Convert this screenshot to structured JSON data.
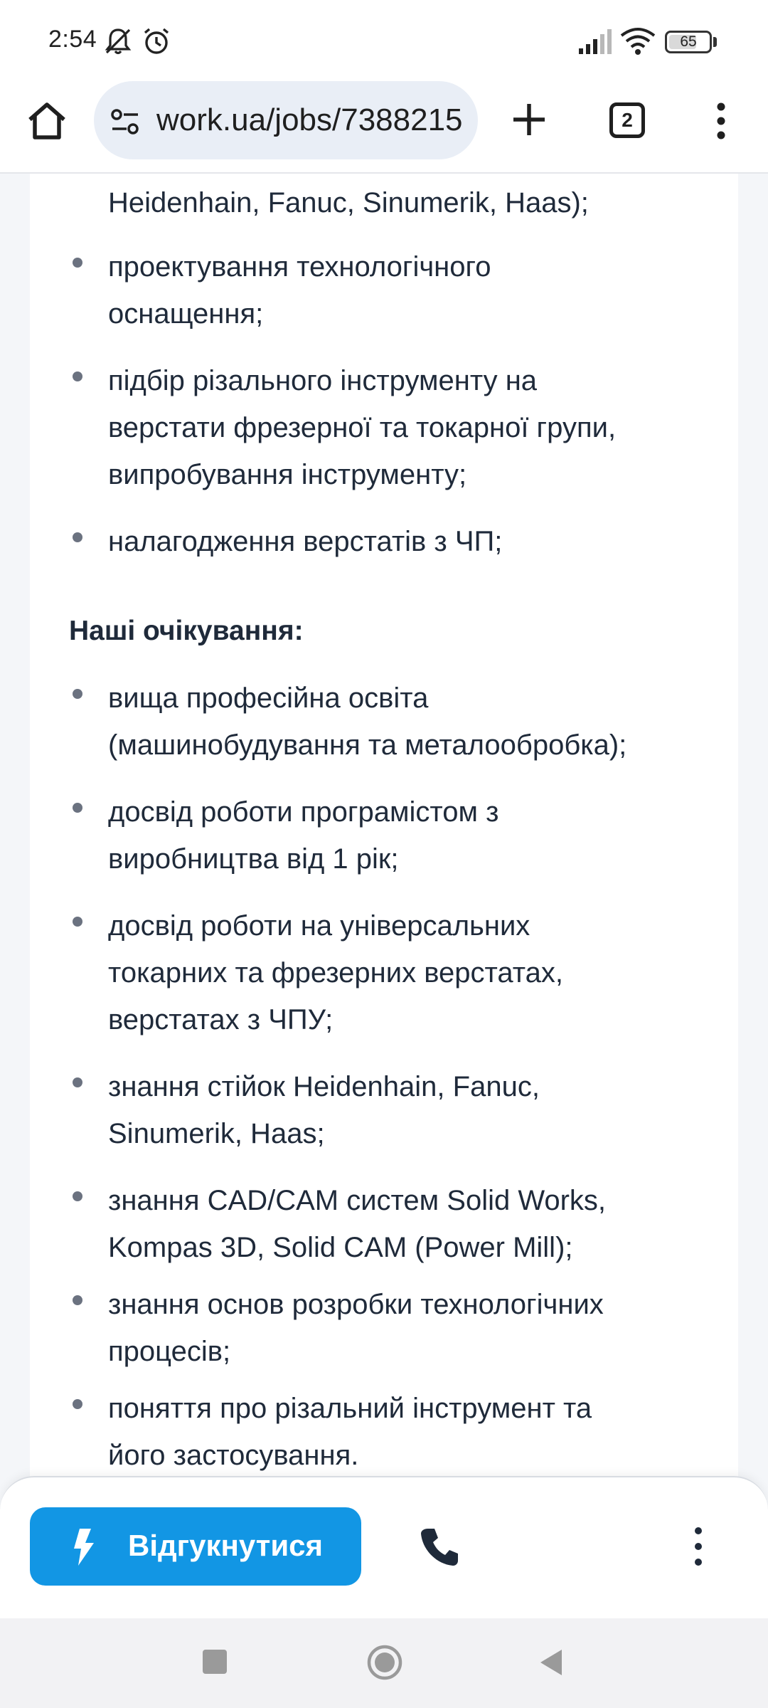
{
  "status_bar": {
    "time": "2:54",
    "battery": "65",
    "icons": [
      "mute-icon",
      "alarm-icon",
      "signal-icon",
      "wifi-icon",
      "battery-icon"
    ]
  },
  "browser": {
    "url": "work.ua/jobs/7388215",
    "tab_count": "2"
  },
  "content": {
    "responsibilities_tail": {
      "partial_first_line": "Heidenhain, Fanuc, Sinumerik, Haas);",
      "items": [
        [
          "проектування технологічного",
          "оснащення;"
        ],
        [
          "підбір різального інструменту на",
          "верстати фрезерної та токарної групи,",
          "випробування інструменту;"
        ],
        [
          "налагодження верстатів з ЧП;"
        ]
      ]
    },
    "expectations": {
      "heading": "Наші очікування:",
      "items": [
        [
          "вища професійна освіта",
          "(машинобудування та металообробка);"
        ],
        [
          "досвід роботи програмістом з",
          "виробництва від 1 рік;"
        ],
        [
          "досвід роботи на універсальних",
          "токарних та фрезерних верстатах,",
          "верстатах з ЧПУ;"
        ],
        [
          "знання стійок Heidenhain, Fanuc,",
          "Sinumerik, Haas;"
        ],
        [
          "знання CAD/CAM систем Solid Works,",
          "Kompas 3D, Solid CAM (Power Mill);"
        ],
        [
          "знання основ розробки технологічних",
          "процесів;"
        ],
        [
          "поняття про різальний інструмент та",
          "його застосування."
        ]
      ]
    }
  },
  "action_bar": {
    "apply_label": "Відгукнутися",
    "accent_color": "#1296e4"
  }
}
